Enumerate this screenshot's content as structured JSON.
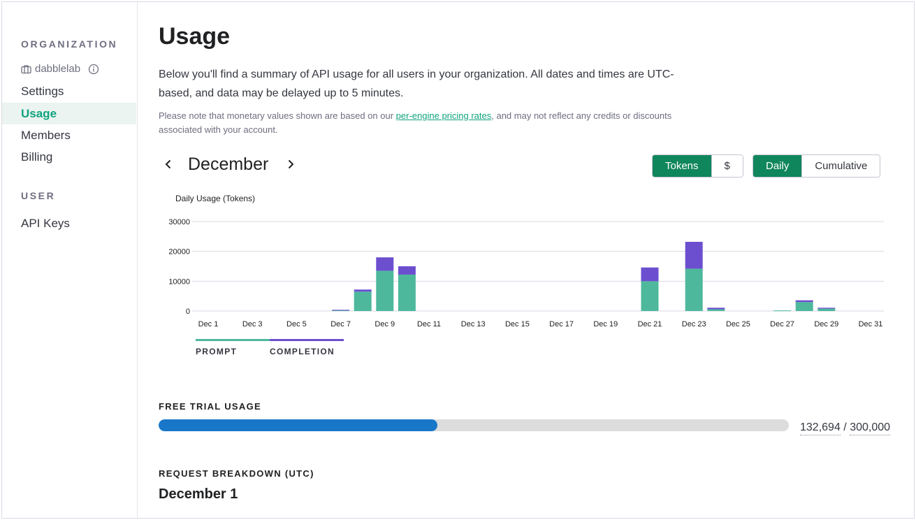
{
  "sidebar": {
    "org_heading": "ORGANIZATION",
    "org_name": "dabblelab",
    "items": [
      {
        "label": "Settings",
        "active": false
      },
      {
        "label": "Usage",
        "active": true
      },
      {
        "label": "Members",
        "active": false
      },
      {
        "label": "Billing",
        "active": false
      }
    ],
    "user_heading": "USER",
    "user_items": [
      {
        "label": "API Keys"
      }
    ]
  },
  "main": {
    "title": "Usage",
    "description": "Below you'll find a summary of API usage for all users in your organization. All dates and times are UTC-based, and data may be delayed up to 5 minutes.",
    "note_before": "Please note that monetary values shown are based on our ",
    "note_link": "per-engine pricing rates",
    "note_after": ", and may not reflect any credits or discounts associated with your account.",
    "month": "December",
    "unit_toggle": {
      "options": [
        "Tokens",
        "$"
      ],
      "selected": "Tokens"
    },
    "mode_toggle": {
      "options": [
        "Daily",
        "Cumulative"
      ],
      "selected": "Daily"
    },
    "free_trial": {
      "heading": "FREE TRIAL USAGE",
      "used": "132,694",
      "separator": "/",
      "limit": "300,000",
      "fraction": 0.4423
    },
    "breakdown": {
      "heading": "REQUEST BREAKDOWN (UTC)",
      "day_title": "December 1"
    }
  },
  "colors": {
    "accent": "#10a37f",
    "toggle_active": "#10865d",
    "prompt": "#4db89c",
    "completion": "#6b4fcf",
    "progress_fill": "#1877c9"
  },
  "chart_data": {
    "type": "bar",
    "stacked": true,
    "title": "Daily Usage (Tokens)",
    "ylim": [
      0,
      30000
    ],
    "yticks": [
      0,
      10000,
      20000,
      30000
    ],
    "x_tick_labels": [
      "Dec 1",
      "Dec 3",
      "Dec 5",
      "Dec 7",
      "Dec 9",
      "Dec 11",
      "Dec 13",
      "Dec 15",
      "Dec 17",
      "Dec 19",
      "Dec 21",
      "Dec 23",
      "Dec 25",
      "Dec 27",
      "Dec 29",
      "Dec 31"
    ],
    "categories": [
      "Dec 1",
      "Dec 2",
      "Dec 3",
      "Dec 4",
      "Dec 5",
      "Dec 6",
      "Dec 7",
      "Dec 8",
      "Dec 9",
      "Dec 10",
      "Dec 11",
      "Dec 12",
      "Dec 13",
      "Dec 14",
      "Dec 15",
      "Dec 16",
      "Dec 17",
      "Dec 18",
      "Dec 19",
      "Dec 20",
      "Dec 21",
      "Dec 22",
      "Dec 23",
      "Dec 24",
      "Dec 25",
      "Dec 26",
      "Dec 27",
      "Dec 28",
      "Dec 29",
      "Dec 30",
      "Dec 31"
    ],
    "series": [
      {
        "name": "PROMPT",
        "color": "#4db89c",
        "values": [
          0,
          0,
          0,
          0,
          0,
          0,
          300,
          6500,
          13500,
          12200,
          0,
          0,
          0,
          0,
          0,
          0,
          0,
          0,
          0,
          0,
          10000,
          0,
          14200,
          600,
          0,
          0,
          200,
          3000,
          800,
          0,
          0
        ]
      },
      {
        "name": "COMPLETION",
        "color": "#6b4fcf",
        "values": [
          0,
          0,
          0,
          0,
          0,
          0,
          100,
          700,
          4500,
          2800,
          0,
          0,
          0,
          0,
          0,
          0,
          0,
          0,
          0,
          0,
          4600,
          0,
          9000,
          500,
          0,
          0,
          0,
          600,
          300,
          0,
          0
        ]
      }
    ],
    "grid": true,
    "legend_position": "bottom-left"
  }
}
